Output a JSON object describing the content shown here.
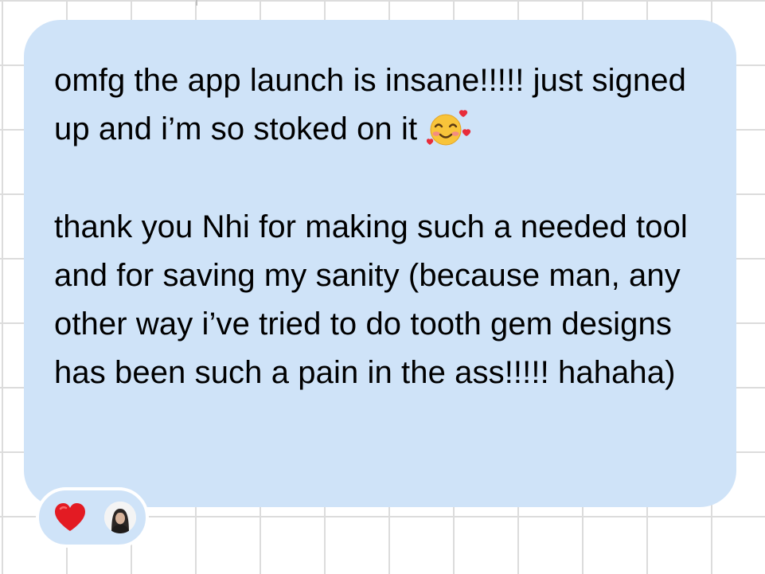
{
  "message": {
    "paragraph_1": "omfg the app launch is insane!!!!! just signed up and i’m so stoked on it",
    "paragraph_1_emoji": "smiling-face-with-hearts",
    "paragraph_2": "thank you Nhi for making such a needed tool and for saving my sanity (because man, any other way i’ve tried to do tooth gem designs has been such a pain in the ass!!!!! hahaha)"
  },
  "reactions": {
    "emoji": "red-heart",
    "reactor": "user-avatar"
  },
  "colors": {
    "bubble": "#cfe3f8",
    "text": "#000000",
    "heart": "#e31b23",
    "grid_line": "#dcdcdc",
    "background": "#ffffff"
  }
}
